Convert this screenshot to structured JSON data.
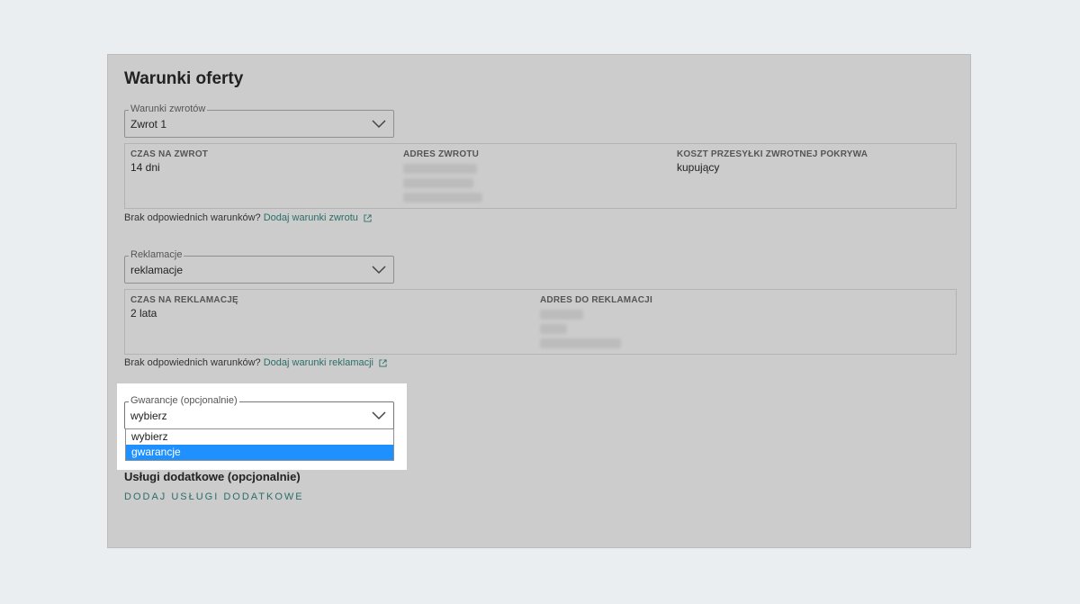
{
  "page": {
    "title": "Warunki oferty"
  },
  "returns": {
    "legend": "Warunki zwrotów",
    "selected": "Zwrot 1",
    "details": {
      "time_header": "CZAS NA ZWROT",
      "time_value": "14 dni",
      "address_header": "ADRES ZWROTU",
      "cost_header": "KOSZT PRZESYŁKI ZWROTNEJ POKRYWA",
      "cost_value": "kupujący"
    },
    "hint_text": "Brak odpowiednich warunków?",
    "hint_link": "Dodaj warunki zwrotu"
  },
  "complaints": {
    "legend": "Reklamacje",
    "selected": "reklamacje",
    "details": {
      "time_header": "CZAS NA REKLAMACJĘ",
      "time_value": "2 lata",
      "address_header": "ADRES DO REKLAMACJI"
    },
    "hint_text": "Brak odpowiednich warunków?",
    "hint_link": "Dodaj warunki reklamacji"
  },
  "warranty": {
    "legend": "Gwarancje (opcjonalnie)",
    "selected": "wybierz",
    "options": [
      "wybierz",
      "gwarancje"
    ],
    "highlighted_option": "gwarancje"
  },
  "additional": {
    "title": "Usługi dodatkowe (opcjonalnie)",
    "add_label": "DODAJ USŁUGI DODATKOWE"
  },
  "colors": {
    "link": "#2b6e68",
    "highlight": "#1e90ff",
    "card": "#cccccc"
  },
  "icons": {
    "chevron": "chevron-down-icon",
    "external": "external-link-icon"
  }
}
